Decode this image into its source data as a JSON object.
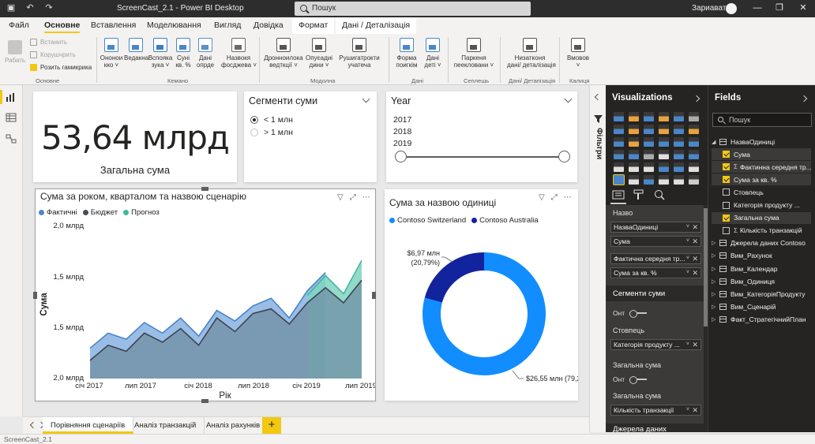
{
  "titlebar": {
    "title": "ScreenCast_2.1 - Power BI Desktop",
    "search_placeholder": "Пошук",
    "user": "Зариавата"
  },
  "menu": {
    "tabs": [
      "Файл",
      "Основне",
      "Вставлення",
      "Моделювання",
      "Вигляд",
      "Довідка",
      "Формат",
      "Дані / Деталізація"
    ],
    "active": "Основне"
  },
  "ribbon": {
    "clipboard": {
      "paste": "Рабать",
      "cut": "Встанить",
      "copy": "Корушчрить",
      "format_painter": "Розить гамикрика",
      "group": "Основне"
    },
    "buttons": [
      {
        "label": "Ононои\nкко ˅",
        "color": "#4a86c8"
      },
      {
        "label": "Ведакна",
        "color": "#4a86c8"
      },
      {
        "label": "Вспояка\nзука ˅",
        "color": "#3a7dc5"
      },
      {
        "label": "Суні\nкв. %",
        "color": "#4a86c8"
      },
      {
        "label": "Дані\nопрде",
        "color": "#5b8fc7"
      },
      {
        "label": "Назвокя\nфосджева ˅",
        "color": "#6a6a6a"
      },
      {
        "label": "Дронноилока\nведткції ˅",
        "color": "#555555"
      },
      {
        "label": "Опуєадиі\nдини ˅",
        "color": "#555555"
      },
      {
        "label": "Рушигатрокти\nучатеча",
        "color": "#555555"
      },
      {
        "label": "Форма\nпоигкім",
        "color": "#4a86c8"
      },
      {
        "label": "Дані\nдеті ˅",
        "color": "#4a86c8"
      },
      {
        "label": "Паркеня\nпеекловани ˅",
        "color": "#555555"
      },
      {
        "label": "Низатконя\nдані/ деталізація",
        "color": "#555555"
      },
      {
        "label": "Вмовов\n˅",
        "color": "#555555"
      }
    ],
    "groups": [
      "Кемано",
      "Модолна",
      "Дані",
      "Сеплешь",
      "Дані/ Детапізація",
      "Калиця"
    ]
  },
  "kpi": {
    "value": "53,64 млрд",
    "label": "Загальна сума"
  },
  "slicer_amount": {
    "title": "Сегменти суми",
    "options": [
      {
        "label": "< 1 млн",
        "selected": true
      },
      {
        "label": "> 1 млн",
        "selected": false
      }
    ]
  },
  "slicer_year": {
    "title": "Year",
    "years": [
      "2017",
      "2018",
      "2019"
    ]
  },
  "area_chart": {
    "title": "Сума за роком, кварталом та назвою сценарію",
    "legend": [
      {
        "name": "Фактичні",
        "color": "#4a86c8"
      },
      {
        "name": "Бюджет",
        "color": "#444c56"
      },
      {
        "name": "Прогноз",
        "color": "#3fb8a0"
      }
    ]
  },
  "chart_data": [
    {
      "type": "area",
      "title": "Сума за роком, кварталом та назвою сценарію",
      "xlabel": "Рік",
      "ylabel": "Сума",
      "x_tick_labels": [
        "січ 2017",
        "лип 2017",
        "січ 2018",
        "лип 2018",
        "січ 2019",
        "лип 2019"
      ],
      "y_tick_labels": [
        "2,0 млрд",
        "1,5 млрд",
        "1,5 млрд",
        "2,0 млрд"
      ],
      "ylim": [
        0,
        100
      ],
      "x": [
        0,
        1,
        2,
        3,
        4,
        5,
        6,
        7,
        8,
        9,
        10,
        11,
        12,
        13,
        14,
        15
      ],
      "series": [
        {
          "name": "Фактичні",
          "color": "#7aa7d9",
          "values": [
            20,
            30,
            26,
            37,
            30,
            40,
            28,
            45,
            38,
            48,
            53,
            40,
            58,
            70,
            null,
            null
          ]
        },
        {
          "name": "Бюджет",
          "color": "#444c56",
          "values": [
            12,
            22,
            18,
            30,
            24,
            33,
            22,
            40,
            31,
            43,
            46,
            36,
            50,
            60,
            50,
            65
          ]
        },
        {
          "name": "Прогноз",
          "color": "#3fb8a0",
          "values": [
            null,
            null,
            null,
            null,
            null,
            null,
            null,
            null,
            null,
            null,
            null,
            null,
            55,
            68,
            56,
            78
          ]
        }
      ],
      "grid": false,
      "legend_position": "top-left"
    },
    {
      "type": "pie",
      "title": "Сума за назвою одиниці",
      "categories": [
        "Contoso Switzerland",
        "Contoso Australia"
      ],
      "values": [
        26.55,
        6.97
      ],
      "colors": [
        "#118dff",
        "#12239e"
      ],
      "labels": [
        "$26,55 млн (79,21%)",
        "$6,97 млн\n(20,79%)"
      ],
      "donut": true,
      "legend_position": "top-left"
    }
  ],
  "donut_chart": {
    "title": "Сума за назвою одиниці",
    "legend": [
      {
        "name": "Contoso Switzerland",
        "color": "#118dff"
      },
      {
        "name": "Contoso Australia",
        "color": "#12239e"
      }
    ],
    "label_big": "$26,55 млн (79,21%)",
    "label_small_line1": "$6,97 млн",
    "label_small_line2": "(20,79%)"
  },
  "filters_pane": {
    "label": "Фільтри"
  },
  "visualizations": {
    "title": "Visualizations",
    "wells": {
      "values_label": "Назво",
      "values": [
        "НазваОдиниці",
        "Сума",
        "Фактична середня тр...",
        "Сума за кв. %"
      ],
      "section1_title": "Сегменти суми",
      "toggle1": "Онт",
      "columns_label": "Стовпець",
      "columns_value": "Категорія продукту ...",
      "total_label": "Загальна сума",
      "toggle2": "Онт",
      "total_label2": "Загальна сума",
      "total_value": "Кількість транзакції",
      "more": "Джерела даних"
    }
  },
  "fields": {
    "title": "Fields",
    "search_placeholder": "Пошук",
    "tree": [
      {
        "type": "table",
        "name": "НазваОдиниці",
        "expanded": true
      },
      {
        "type": "field",
        "name": "Сума",
        "checked": true,
        "sigma": false
      },
      {
        "type": "field",
        "name": "Фактинна середня тр...",
        "checked": true,
        "sigma": true
      },
      {
        "type": "field",
        "name": "Сума за кв. %",
        "checked": true,
        "sigma": false
      },
      {
        "type": "field",
        "name": "Стовпець",
        "checked": false,
        "sigma": false
      },
      {
        "type": "field",
        "name": "Категорія продукту ...",
        "checked": false,
        "sigma": false
      },
      {
        "type": "field",
        "name": "Загальна сума",
        "checked": true,
        "sigma": false
      },
      {
        "type": "field",
        "name": "Кількість транзакцій",
        "checked": false,
        "sigma": true
      },
      {
        "type": "table",
        "name": "Джерела даних Contoso",
        "expanded": false
      },
      {
        "type": "table",
        "name": "Вим_Рахунок",
        "expanded": false
      },
      {
        "type": "table",
        "name": "Вим_Календар",
        "expanded": false
      },
      {
        "type": "table",
        "name": "Вим_Одиниця",
        "expanded": false
      },
      {
        "type": "table",
        "name": "Вим_КатегоріяПродукту",
        "expanded": false
      },
      {
        "type": "table",
        "name": "Вим_Сценарій",
        "expanded": false
      },
      {
        "type": "table",
        "name": "Факт_СтратегічнийПлан",
        "expanded": false
      }
    ]
  },
  "pages": {
    "tabs": [
      "Порівняння сценаріїв",
      "Аналіз транзакцій",
      "Аналіз рахунків"
    ],
    "active": 0,
    "add": "+"
  },
  "status": {
    "text": "ScreenCast_2.1"
  }
}
